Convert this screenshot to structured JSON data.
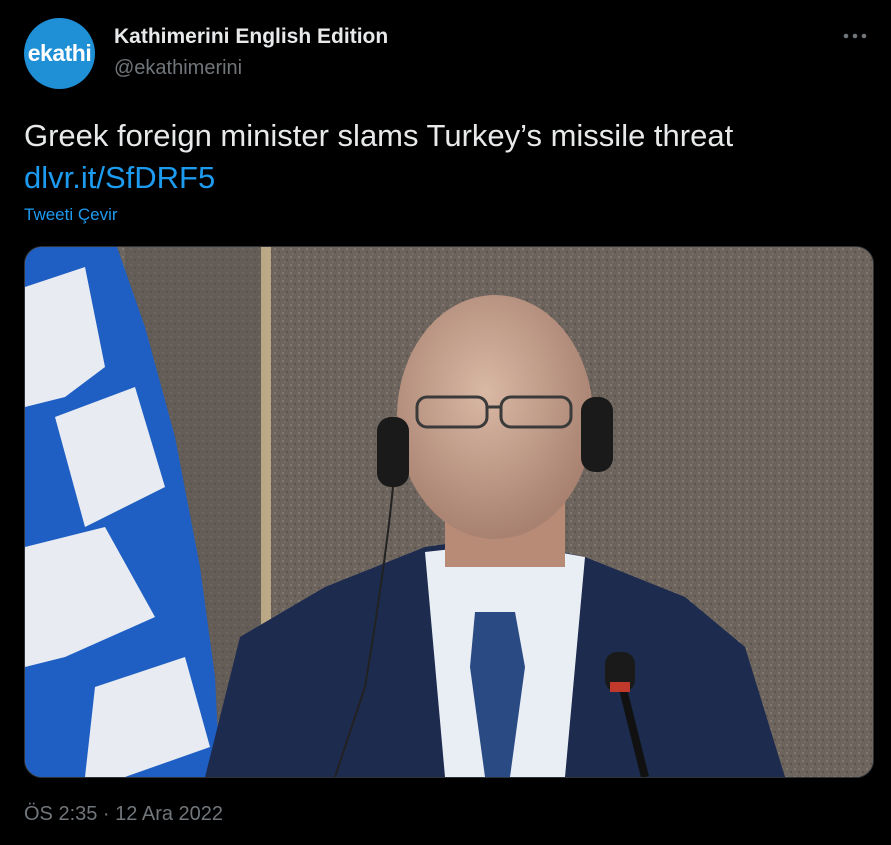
{
  "account": {
    "avatar_text": "ekathi",
    "display_name": "Kathimerini English Edition",
    "handle": "@ekathimerini"
  },
  "tweet": {
    "text": "Greek foreign minister slams Turkey’s missile threat",
    "link": "dlvr.it/SfDRF5",
    "translate_label": "Tweeti Çevir",
    "timestamp": "ÖS 2:35 · 12 Ara 2022"
  },
  "icons": {
    "more": "more-horizontal-icon"
  },
  "colors": {
    "background": "#000000",
    "link": "#1d9bf0",
    "secondary_text": "#71767b",
    "primary_text": "#e7e9ea",
    "avatar_bg": "#1f8fd6",
    "flag_blue": "#1f5fc4"
  }
}
